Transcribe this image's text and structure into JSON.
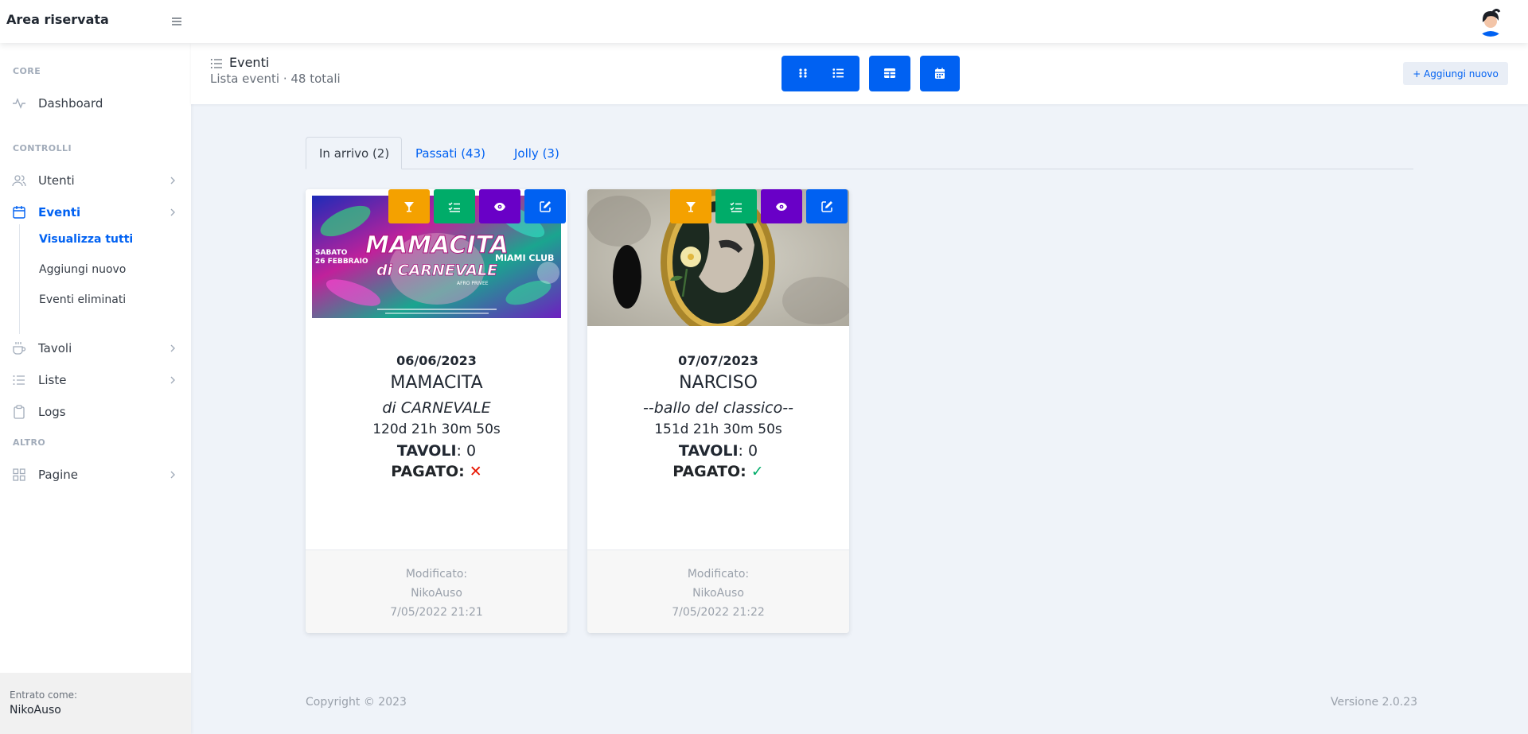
{
  "brand": {
    "title": "Area riservata"
  },
  "sidebar": {
    "heading_core": "CORE",
    "heading_controlli": "CONTROLLI",
    "heading_altro": "ALTRO",
    "dashboard": "Dashboard",
    "utenti": "Utenti",
    "eventi": "Eventi",
    "eventi_sub": [
      "Visualizza tutti",
      "Aggiungi nuovo",
      "Eventi eliminati"
    ],
    "tavoli": "Tavoli",
    "liste": "Liste",
    "logs": "Logs",
    "pagine": "Pagine",
    "footer_subtitle": "Entrato come:",
    "footer_user": "NikoAuso"
  },
  "header": {
    "title": "Eventi",
    "subtitle": "Lista eventi · 48 totali",
    "add_new": "+ Aggiungi nuovo"
  },
  "tabs": [
    "In arrivo (2)",
    "Passati (43)",
    "Jolly (3)"
  ],
  "events": [
    {
      "date": "06/06/2023",
      "title": "MAMACITA",
      "subtitle": "di CARNEVALE",
      "countdown": "120d 21h 30m 50s",
      "tavoli_label": "TAVOLI",
      "tavoli_value": ": 0",
      "pagato_label": "PAGATO",
      "pagato_sep": ":",
      "pagato_mark": "✕",
      "modified_label": "Modificato:",
      "modified_by": "NikoAuso",
      "modified_at": "7/05/2022 21:21",
      "poster_texts": [
        "MAMACITA",
        "di CARNEVALE",
        "SABATO",
        "26 FEBBRAIO",
        "MIAMI CLUB",
        "AFRO PRIVEE"
      ]
    },
    {
      "date": "07/07/2023",
      "title": "NARCISO",
      "subtitle": "--ballo del classico--",
      "countdown": "151d 21h 30m 50s",
      "tavoli_label": "TAVOLI",
      "tavoli_value": ": 0",
      "pagato_label": "PAGATO",
      "pagato_sep": ":",
      "pagato_mark": "✓",
      "modified_label": "Modificato:",
      "modified_by": "NikoAuso",
      "modified_at": "7/05/2022 21:22"
    }
  ],
  "footer": {
    "copyright": "Copyright © 2023",
    "version": "Versione 2.0.23"
  },
  "colors": {
    "primary": "#0061f2",
    "orange": "#f4a100",
    "green": "#00ac69",
    "purple": "#6900c7",
    "danger": "#e81500",
    "success": "#00ac69"
  },
  "icons": {
    "menu": "hamburger-icon",
    "dashboard": "activity-icon",
    "utenti": "users-icon",
    "eventi": "calendar-icon",
    "tavoli": "coffee-icon",
    "liste": "list-icon",
    "logs": "clipboard-icon",
    "pagine": "grid-icon",
    "actions": [
      "cocktail-icon",
      "checklist-icon",
      "eye-icon",
      "edit-icon"
    ]
  }
}
